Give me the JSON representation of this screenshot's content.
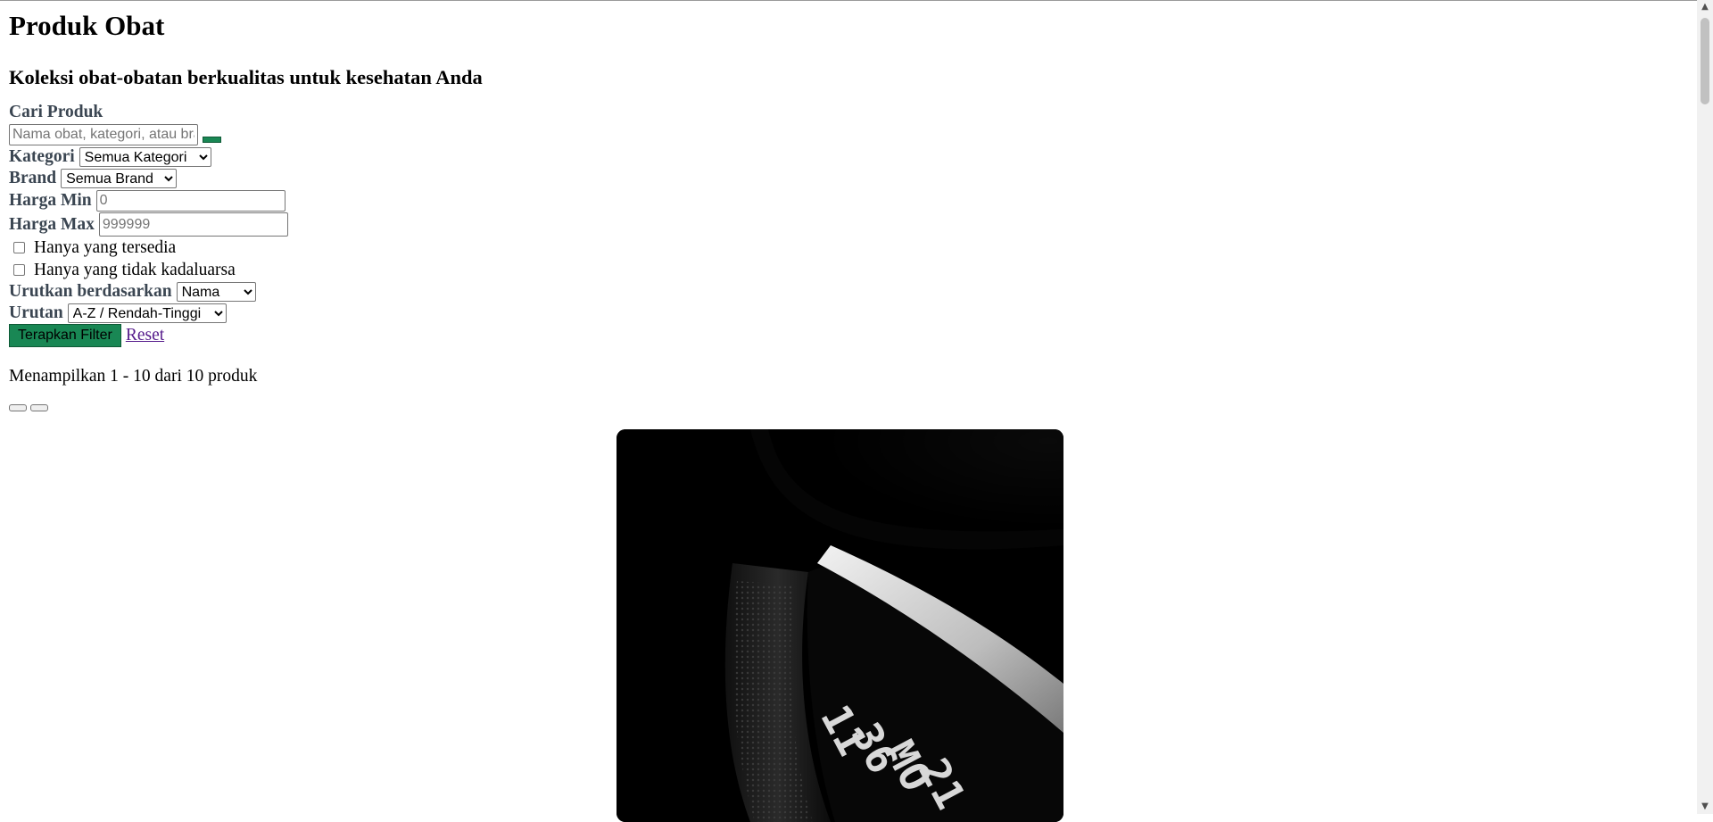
{
  "header": {
    "title": "Produk Obat",
    "subtitle": "Koleksi obat-obatan berkualitas untuk kesehatan Anda"
  },
  "filters": {
    "search_label": "Cari Produk",
    "search_placeholder": "Nama obat, kategori, atau brand",
    "category_label": "Kategori",
    "category_value": "Semua Kategori",
    "brand_label": "Brand",
    "brand_value": "Semua Brand",
    "min_price_label": "Harga Min",
    "min_price_placeholder": "0",
    "max_price_label": "Harga Max",
    "max_price_placeholder": "999999",
    "in_stock_label": "Hanya yang tersedia",
    "not_expired_label": "Hanya yang tidak kadaluarsa",
    "sort_by_label": "Urutkan berdasarkan",
    "sort_by_value": "Nama",
    "order_label": "Urutan",
    "order_value": "A-Z / Rendah-Tinggi",
    "apply_label": "Terapkan Filter",
    "reset_label": "Reset"
  },
  "results": {
    "summary": "Menampilkan 1 - 10 dari 10 produk"
  },
  "product_image": {
    "watch_digits": [
      "11",
      "36",
      "MO",
      "21"
    ]
  },
  "colors": {
    "accent_green": "#198754",
    "label_gray": "#3b4652",
    "link_purple": "#551a8b"
  }
}
